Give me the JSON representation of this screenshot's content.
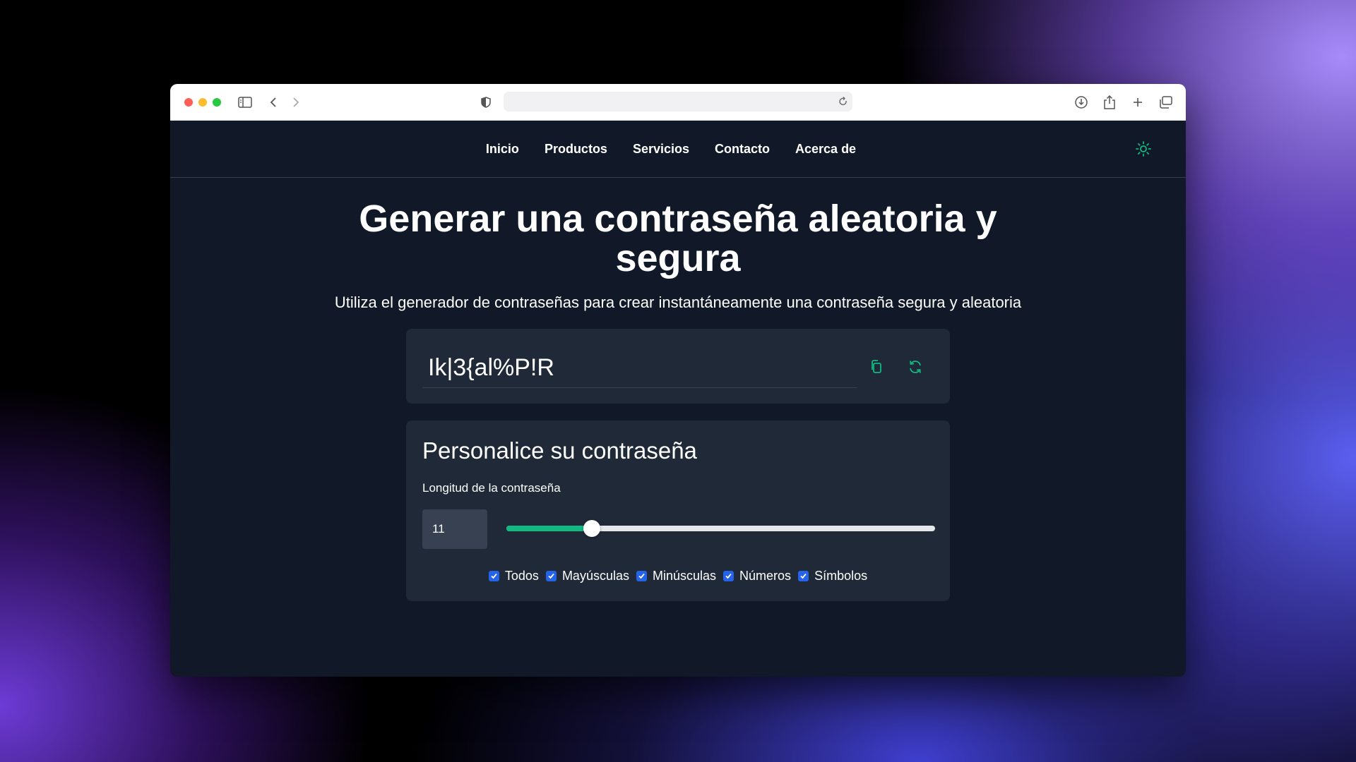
{
  "browser": {
    "url": ""
  },
  "nav": {
    "items": [
      {
        "label": "Inicio"
      },
      {
        "label": "Productos"
      },
      {
        "label": "Servicios"
      },
      {
        "label": "Contacto"
      },
      {
        "label": "Acerca de"
      }
    ],
    "theme_icon": "sun-icon"
  },
  "hero": {
    "title": "Generar una contraseña aleatoria y segura",
    "subtitle": "Utiliza el generador de contraseñas para crear instantáneamente una contraseña segura y aleatoria"
  },
  "generator": {
    "password": "Ik|3{al%P!R",
    "copy_icon": "copy-icon",
    "refresh_icon": "refresh-icon"
  },
  "customize": {
    "title": "Personalice su contraseña",
    "length_label": "Longitud de la contraseña",
    "length_value": "11",
    "slider_fraction": 0.2,
    "options": [
      {
        "label": "Todos",
        "checked": true
      },
      {
        "label": "Mayúsculas",
        "checked": true
      },
      {
        "label": "Minúsculas",
        "checked": true
      },
      {
        "label": "Números",
        "checked": true
      },
      {
        "label": "Símbolos",
        "checked": true
      }
    ]
  },
  "colors": {
    "accent": "#10b981",
    "page_bg": "#111827",
    "card_bg": "#1f2937",
    "checkbox": "#2563eb"
  }
}
